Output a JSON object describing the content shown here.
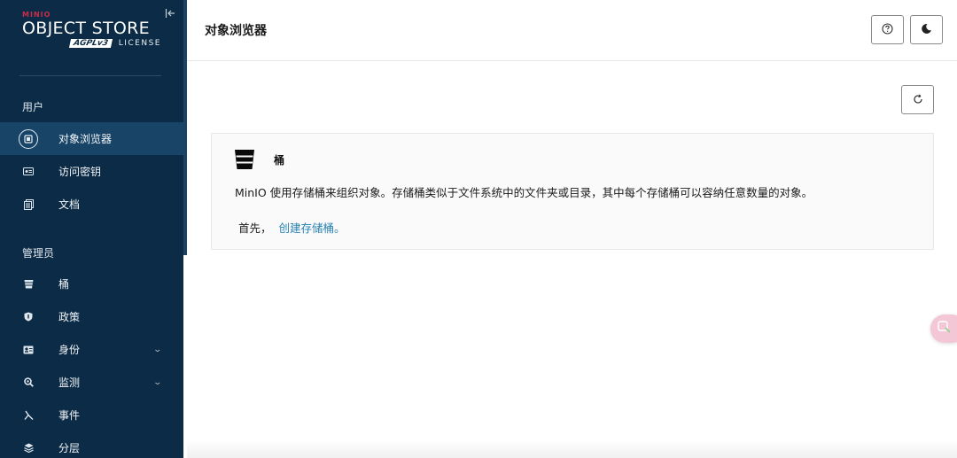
{
  "brand": {
    "mini": "MINIO",
    "product": "OBJECT STORE",
    "agpl": "AGPLv3",
    "license": "LICENSE"
  },
  "sidebar": {
    "section_user": "用户",
    "section_admin": "管理员",
    "user_items": [
      {
        "label": "对象浏览器",
        "icon": "object-browser-icon",
        "active": true
      },
      {
        "label": "访问密钥",
        "icon": "access-keys-icon"
      },
      {
        "label": "文档",
        "icon": "documentation-icon"
      }
    ],
    "admin_items": [
      {
        "label": "桶",
        "icon": "bucket-icon"
      },
      {
        "label": "政策",
        "icon": "policy-icon"
      },
      {
        "label": "身份",
        "icon": "identity-icon",
        "expandable": true
      },
      {
        "label": "监测",
        "icon": "monitoring-icon",
        "expandable": true
      },
      {
        "label": "事件",
        "icon": "events-icon"
      },
      {
        "label": "分层",
        "icon": "tiers-icon"
      }
    ]
  },
  "header": {
    "title": "对象浏览器",
    "help_icon": "help-circle-icon",
    "theme_icon": "moon-icon"
  },
  "main": {
    "refresh_icon": "refresh-icon",
    "card": {
      "title": "桶",
      "description": "MinIO 使用存储桶来组织对象。存储桶类似于文件系统中的文件夹或目录，其中每个存储桶可以容纳任意数量的对象。",
      "cta_prefix": "首先，",
      "cta_link": "创建存储桶。"
    }
  },
  "colors": {
    "sidebar_bg": "#0c2b46",
    "sidebar_active": "#174467",
    "link": "#2781b0",
    "brand_red": "#c72e49"
  }
}
